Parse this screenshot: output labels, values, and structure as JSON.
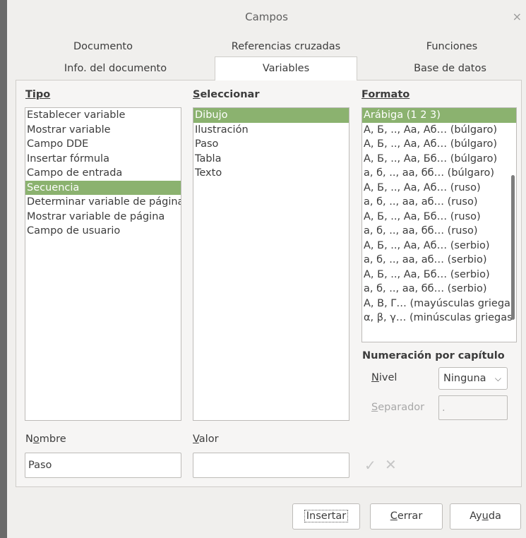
{
  "window": {
    "title": "Campos",
    "close_glyph": "×"
  },
  "tabs": [
    {
      "label": "Documento"
    },
    {
      "label": "Referencias cruzadas"
    },
    {
      "label": "Funciones"
    },
    {
      "label": "Info. del documento"
    },
    {
      "label": "Variables",
      "active": true
    },
    {
      "label": "Base de datos"
    }
  ],
  "tipo": {
    "heading": "Tipo",
    "items": [
      "Establecer variable",
      "Mostrar variable",
      "Campo DDE",
      "Insertar fórmula",
      "Campo de entrada",
      "Secuencia",
      "Determinar variable de página",
      "Mostrar variable de página",
      "Campo de usuario"
    ],
    "selected": "Secuencia"
  },
  "seleccionar": {
    "heading": "Seleccionar",
    "items": [
      "Dibujo",
      "Ilustración",
      "Paso",
      "Tabla",
      "Texto"
    ],
    "selected": "Dibujo"
  },
  "formato": {
    "heading": "Formato",
    "items": [
      "Arábiga (1 2 3)",
      "А, Б, .., Аа, Аб… (búlgaro)",
      "А, Б, .., Аа, Аб… (búlgaro)",
      "А, Б, .., Аа, Бб… (búlgaro)",
      "а, б, .., аа, бб… (búlgaro)",
      "А, Б, .., Аа, Аб… (ruso)",
      "а, б, .., аа, аб… (ruso)",
      "А, Б, .., Аа, Бб… (ruso)",
      "а, б, .., аа, бб… (ruso)",
      "А, Б, .., Аа, Аб… (serbio)",
      "а, б, .., аа, аб… (serbio)",
      "А, Б, .., Аа, Бб… (serbio)",
      "а, б, .., аа, бб… (serbio)",
      "Α, Β, Γ… (mayúsculas griega",
      "α, β, γ… (minúsculas griegas"
    ],
    "selected": "Arábiga (1 2 3)"
  },
  "numeracion": {
    "heading": "Numeración por capítulo",
    "nivel_label": "Nivel",
    "nivel_value": "Ninguna",
    "separador_label": "Separador",
    "separador_value": "."
  },
  "nombre": {
    "label": "Nombre",
    "value": "Paso"
  },
  "valor": {
    "label": "Valor",
    "value": ""
  },
  "icons": {
    "apply": "check-icon",
    "delete": "x-icon"
  },
  "buttons": {
    "insertar": "Insertar",
    "cerrar": "Cerrar",
    "ayuda": "Ayuda"
  },
  "colors": {
    "selection": "#8bb26f",
    "dialog_bg": "#f0efed"
  }
}
